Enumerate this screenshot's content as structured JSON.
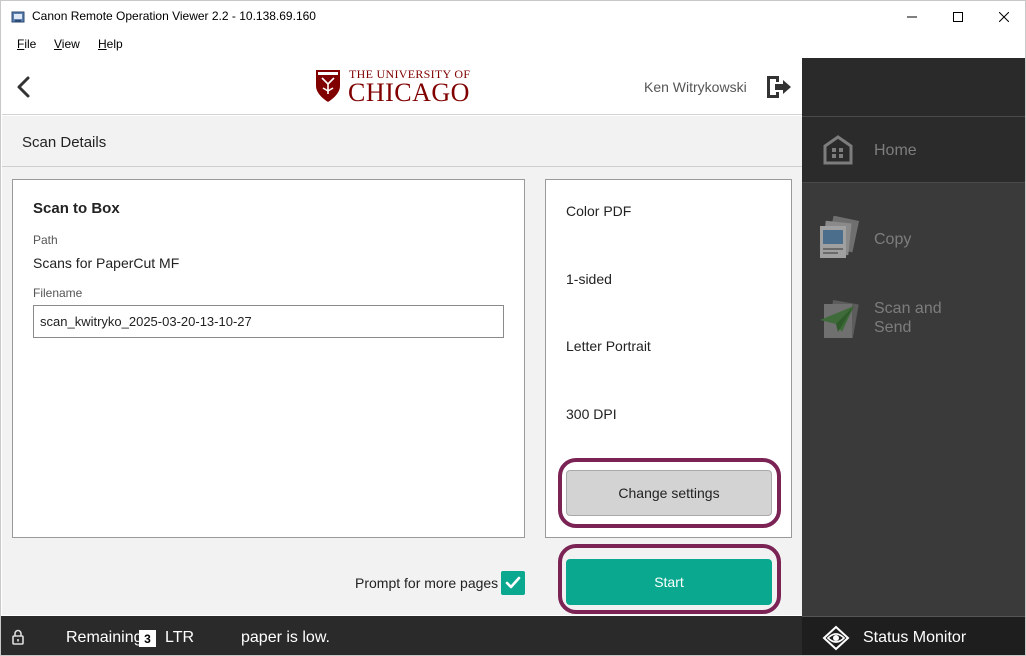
{
  "window": {
    "title": "Canon Remote Operation Viewer 2.2 - 10.138.69.160"
  },
  "menu": {
    "file_first": "F",
    "file_rest": "ile",
    "view_first": "V",
    "view_rest": "iew",
    "help_first": "H",
    "help_rest": "elp"
  },
  "header": {
    "logo_line1": "THE UNIVERSITY OF",
    "logo_line2": "CHICAGO",
    "user_name": "Ken Witrykowski"
  },
  "details": {
    "title": "Scan Details"
  },
  "scan": {
    "title": "Scan to Box",
    "path_label": "Path",
    "path_value": "Scans for PaperCut MF",
    "filename_label": "Filename",
    "filename_value": "scan_kwitryko_2025-03-20-13-10-27"
  },
  "settings": {
    "color": "Color PDF",
    "sides": "1-sided",
    "paper": "Letter Portrait",
    "resolution": "300 DPI",
    "change_label": "Change settings"
  },
  "actions": {
    "prompt_label": "Prompt for more pages",
    "prompt_checked": true,
    "start_label": "Start"
  },
  "sidebar": {
    "home": "Home",
    "copy": "Copy",
    "scan_line1": "Scan and",
    "scan_line2": "Send"
  },
  "status": {
    "remaining_label": "Remaining",
    "remaining_count": "3",
    "unit": "LTR",
    "message": "paper is low.",
    "monitor_label": "Status Monitor"
  },
  "colors": {
    "accent_teal": "#0aa88f",
    "highlight_ring": "#7a2354",
    "uchicago_maroon": "#800000"
  }
}
